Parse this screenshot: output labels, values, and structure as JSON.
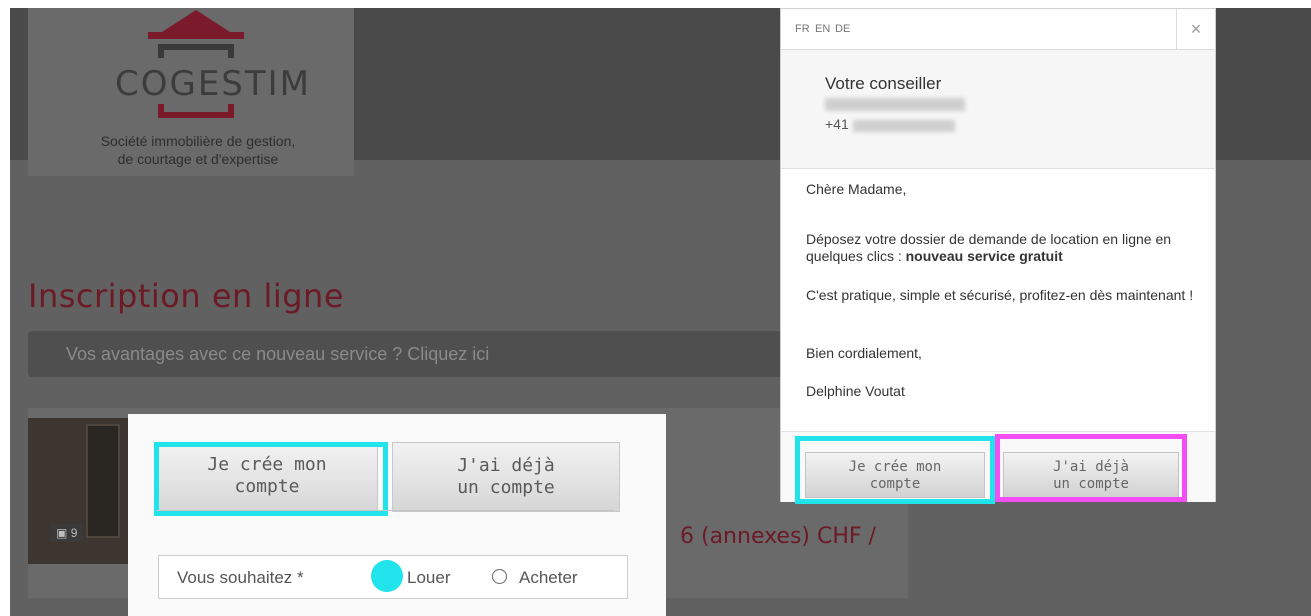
{
  "logo": {
    "name": "COGESTIM",
    "tagline_line1": "Société immobilière de gestion,",
    "tagline_line2": "de courtage et d'expertise"
  },
  "page": {
    "title": "Inscription en ligne",
    "advantages_link": "Vos avantages avec ce nouveau service ? Cliquez ici",
    "photo_count": "9",
    "price_fragment": "6 (annexes) CHF /"
  },
  "form_zoom": {
    "tab_create_line1": "Je crée mon",
    "tab_create_line2": "compte",
    "tab_existing_line1": "J'ai déjà",
    "tab_existing_line2": "un compte",
    "wish_label": "Vous souhaitez *",
    "option_rent": "Louer",
    "option_buy": "Acheter"
  },
  "modal": {
    "languages": [
      "FR",
      "EN",
      "DE"
    ],
    "close": "×",
    "advisor_title": "Votre conseiller",
    "advisor_phone_prefix": "+41",
    "greeting": "Chère Madame,",
    "para1_text": "Déposez votre dossier de demande de location en ligne en quelques clics : ",
    "para1_bold": "nouveau service gratuit",
    "para2": "C'est pratique, simple et sécurisé, profitez-en dès maintenant !",
    "closing": "Bien cordialement,",
    "signature": "Delphine Voutat",
    "btn_create_line1": "Je crée mon",
    "btn_create_line2": "compte",
    "btn_existing_line1": "J'ai déjà",
    "btn_existing_line2": "un compte"
  },
  "colors": {
    "highlight_cyan": "#20e3ec",
    "highlight_magenta": "#f24ef3",
    "brand_red": "#7a1a2b"
  }
}
